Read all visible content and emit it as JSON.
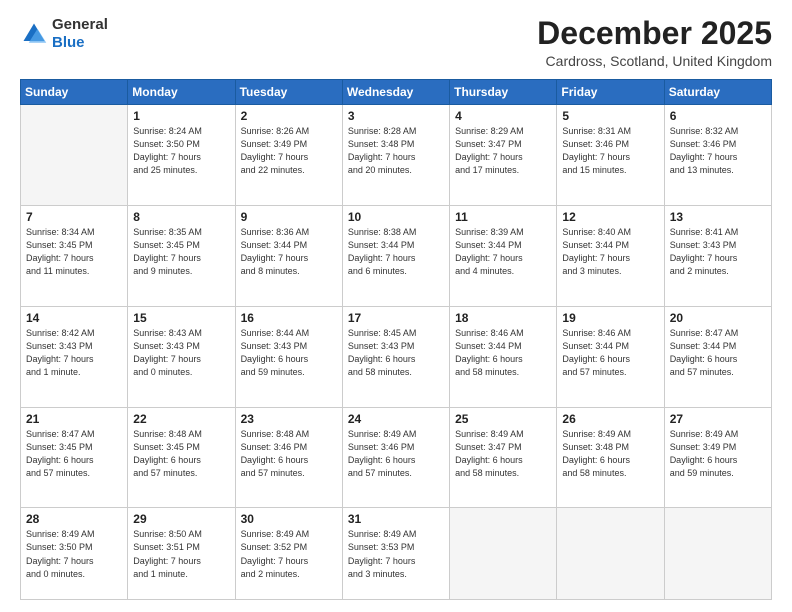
{
  "logo": {
    "general": "General",
    "blue": "Blue"
  },
  "header": {
    "month": "December 2025",
    "location": "Cardross, Scotland, United Kingdom"
  },
  "days_of_week": [
    "Sunday",
    "Monday",
    "Tuesday",
    "Wednesday",
    "Thursday",
    "Friday",
    "Saturday"
  ],
  "weeks": [
    [
      {
        "day": "",
        "info": ""
      },
      {
        "day": "1",
        "info": "Sunrise: 8:24 AM\nSunset: 3:50 PM\nDaylight: 7 hours\nand 25 minutes."
      },
      {
        "day": "2",
        "info": "Sunrise: 8:26 AM\nSunset: 3:49 PM\nDaylight: 7 hours\nand 22 minutes."
      },
      {
        "day": "3",
        "info": "Sunrise: 8:28 AM\nSunset: 3:48 PM\nDaylight: 7 hours\nand 20 minutes."
      },
      {
        "day": "4",
        "info": "Sunrise: 8:29 AM\nSunset: 3:47 PM\nDaylight: 7 hours\nand 17 minutes."
      },
      {
        "day": "5",
        "info": "Sunrise: 8:31 AM\nSunset: 3:46 PM\nDaylight: 7 hours\nand 15 minutes."
      },
      {
        "day": "6",
        "info": "Sunrise: 8:32 AM\nSunset: 3:46 PM\nDaylight: 7 hours\nand 13 minutes."
      }
    ],
    [
      {
        "day": "7",
        "info": "Sunrise: 8:34 AM\nSunset: 3:45 PM\nDaylight: 7 hours\nand 11 minutes."
      },
      {
        "day": "8",
        "info": "Sunrise: 8:35 AM\nSunset: 3:45 PM\nDaylight: 7 hours\nand 9 minutes."
      },
      {
        "day": "9",
        "info": "Sunrise: 8:36 AM\nSunset: 3:44 PM\nDaylight: 7 hours\nand 8 minutes."
      },
      {
        "day": "10",
        "info": "Sunrise: 8:38 AM\nSunset: 3:44 PM\nDaylight: 7 hours\nand 6 minutes."
      },
      {
        "day": "11",
        "info": "Sunrise: 8:39 AM\nSunset: 3:44 PM\nDaylight: 7 hours\nand 4 minutes."
      },
      {
        "day": "12",
        "info": "Sunrise: 8:40 AM\nSunset: 3:44 PM\nDaylight: 7 hours\nand 3 minutes."
      },
      {
        "day": "13",
        "info": "Sunrise: 8:41 AM\nSunset: 3:43 PM\nDaylight: 7 hours\nand 2 minutes."
      }
    ],
    [
      {
        "day": "14",
        "info": "Sunrise: 8:42 AM\nSunset: 3:43 PM\nDaylight: 7 hours\nand 1 minute."
      },
      {
        "day": "15",
        "info": "Sunrise: 8:43 AM\nSunset: 3:43 PM\nDaylight: 7 hours\nand 0 minutes."
      },
      {
        "day": "16",
        "info": "Sunrise: 8:44 AM\nSunset: 3:43 PM\nDaylight: 6 hours\nand 59 minutes."
      },
      {
        "day": "17",
        "info": "Sunrise: 8:45 AM\nSunset: 3:43 PM\nDaylight: 6 hours\nand 58 minutes."
      },
      {
        "day": "18",
        "info": "Sunrise: 8:46 AM\nSunset: 3:44 PM\nDaylight: 6 hours\nand 58 minutes."
      },
      {
        "day": "19",
        "info": "Sunrise: 8:46 AM\nSunset: 3:44 PM\nDaylight: 6 hours\nand 57 minutes."
      },
      {
        "day": "20",
        "info": "Sunrise: 8:47 AM\nSunset: 3:44 PM\nDaylight: 6 hours\nand 57 minutes."
      }
    ],
    [
      {
        "day": "21",
        "info": "Sunrise: 8:47 AM\nSunset: 3:45 PM\nDaylight: 6 hours\nand 57 minutes."
      },
      {
        "day": "22",
        "info": "Sunrise: 8:48 AM\nSunset: 3:45 PM\nDaylight: 6 hours\nand 57 minutes."
      },
      {
        "day": "23",
        "info": "Sunrise: 8:48 AM\nSunset: 3:46 PM\nDaylight: 6 hours\nand 57 minutes."
      },
      {
        "day": "24",
        "info": "Sunrise: 8:49 AM\nSunset: 3:46 PM\nDaylight: 6 hours\nand 57 minutes."
      },
      {
        "day": "25",
        "info": "Sunrise: 8:49 AM\nSunset: 3:47 PM\nDaylight: 6 hours\nand 58 minutes."
      },
      {
        "day": "26",
        "info": "Sunrise: 8:49 AM\nSunset: 3:48 PM\nDaylight: 6 hours\nand 58 minutes."
      },
      {
        "day": "27",
        "info": "Sunrise: 8:49 AM\nSunset: 3:49 PM\nDaylight: 6 hours\nand 59 minutes."
      }
    ],
    [
      {
        "day": "28",
        "info": "Sunrise: 8:49 AM\nSunset: 3:50 PM\nDaylight: 7 hours\nand 0 minutes."
      },
      {
        "day": "29",
        "info": "Sunrise: 8:50 AM\nSunset: 3:51 PM\nDaylight: 7 hours\nand 1 minute."
      },
      {
        "day": "30",
        "info": "Sunrise: 8:49 AM\nSunset: 3:52 PM\nDaylight: 7 hours\nand 2 minutes."
      },
      {
        "day": "31",
        "info": "Sunrise: 8:49 AM\nSunset: 3:53 PM\nDaylight: 7 hours\nand 3 minutes."
      },
      {
        "day": "",
        "info": ""
      },
      {
        "day": "",
        "info": ""
      },
      {
        "day": "",
        "info": ""
      }
    ]
  ]
}
